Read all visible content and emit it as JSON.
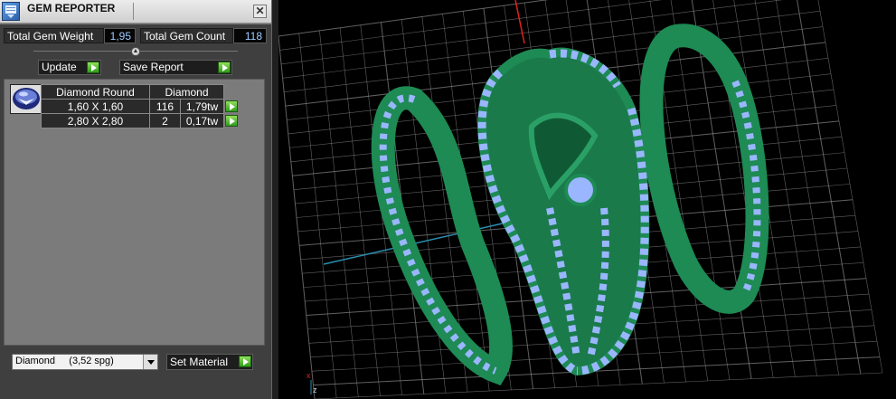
{
  "window": {
    "title": "GEM REPORTER",
    "close_label": "✕"
  },
  "totals": {
    "weight_label": "Total Gem Weight",
    "weight_value": "1,95",
    "count_label": "Total Gem Count",
    "count_value": "118"
  },
  "actions": {
    "update_label": "Update",
    "save_label": "Save Report"
  },
  "gem_group": {
    "shape_header": "Diamond Round",
    "material_header": "Diamond",
    "rows": [
      {
        "size": "1,60 X 1,60",
        "count": "116",
        "weight": "1,79tw"
      },
      {
        "size": "2,80 X 2,80",
        "count": "2",
        "weight": "0,17tw"
      }
    ]
  },
  "material": {
    "selected": "Diamond     (3,52 spg)",
    "set_label": "Set Material"
  },
  "viewport": {
    "axis_labels": {
      "x": "x",
      "z": "z"
    },
    "colors": {
      "metal": "#1e8a54",
      "gem": "#9ab6ff",
      "grid": "#8a8a8a",
      "x_axis": "#e02020",
      "y_axis": "#2a8fb0"
    }
  }
}
